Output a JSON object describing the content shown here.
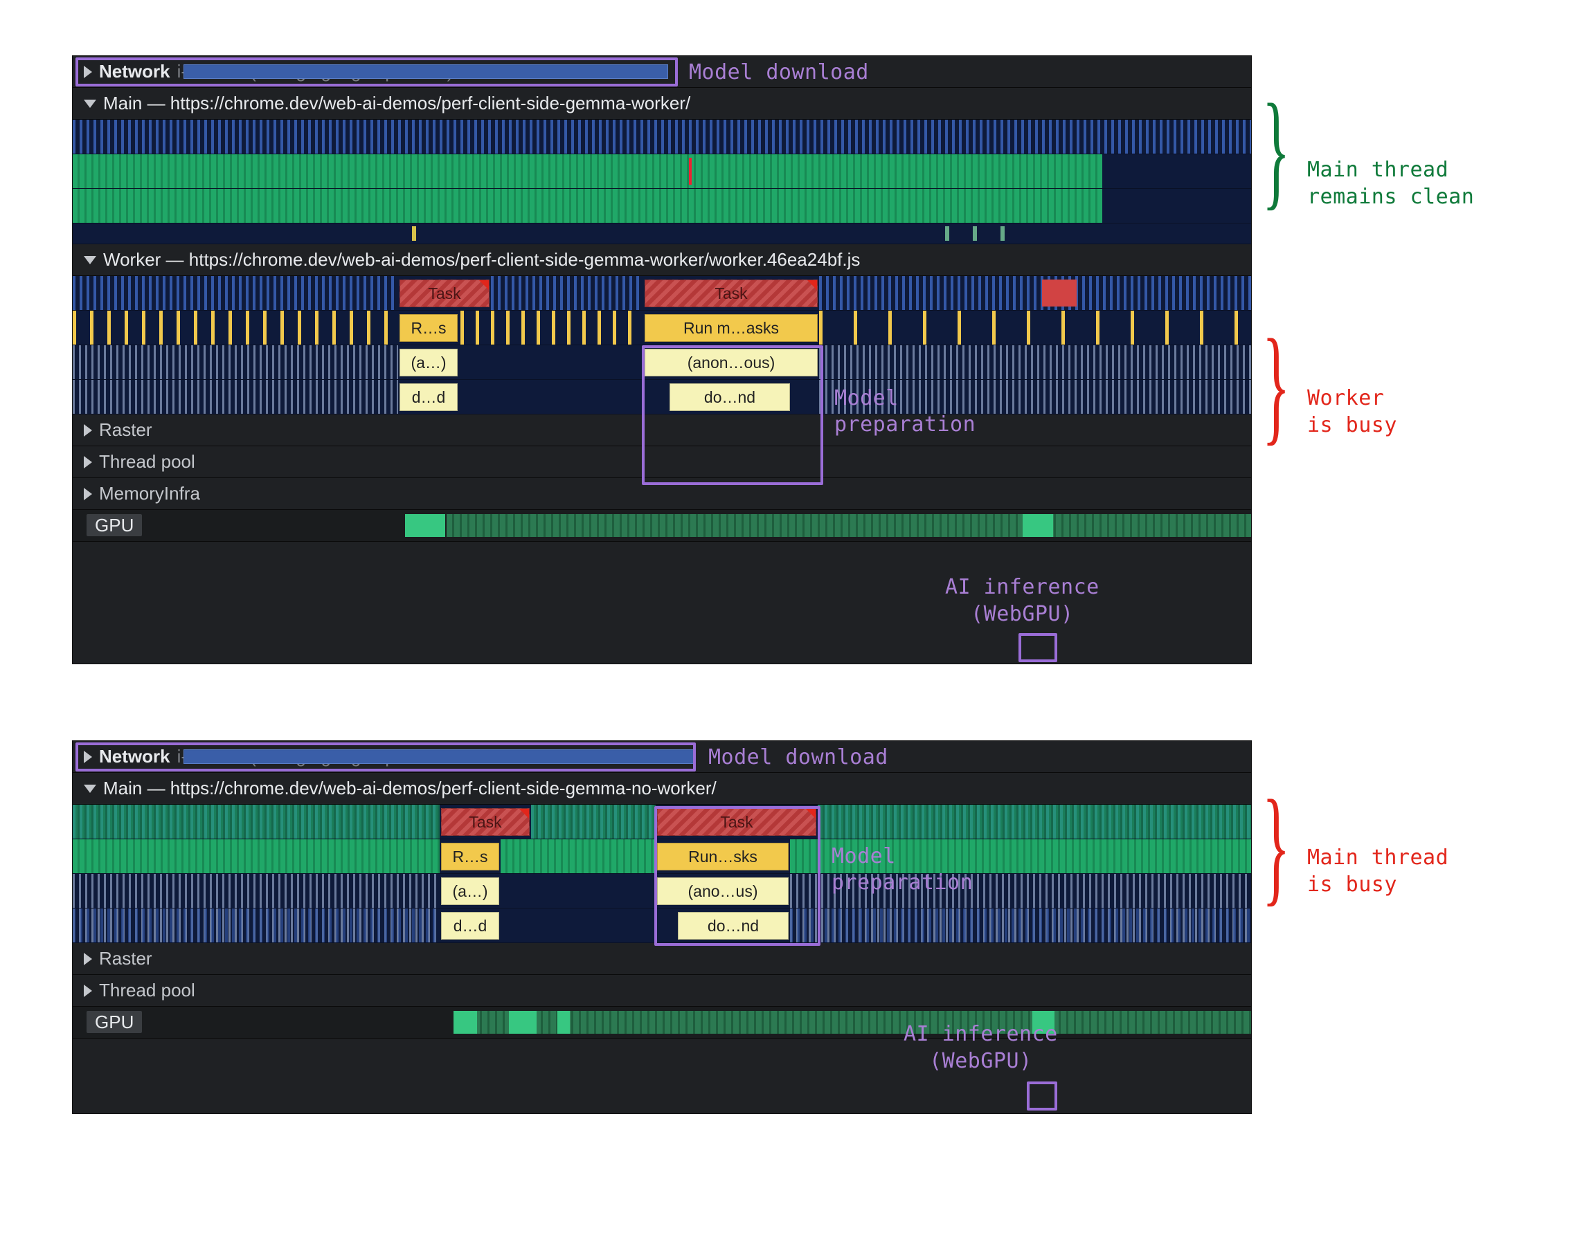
{
  "panel1": {
    "network_label": "Network",
    "network_detail": "i-int4.bin (storage.googleapis.com)",
    "main_label": "Main — https://chrome.dev/web-ai-demos/perf-client-side-gemma-worker/",
    "worker_label": "Worker — https://chrome.dev/web-ai-demos/perf-client-side-gemma-worker/worker.46ea24bf.js",
    "raster_label": "Raster",
    "threadpool_label": "Thread pool",
    "memoryinfra_label": "MemoryInfra",
    "gpu_label": "GPU",
    "worker_tasks": {
      "task_a": "Task",
      "task_b": "Task",
      "rs_a": "R…s",
      "rs_b": "Run m…asks",
      "anon_a": "(a…)",
      "anon_b": "(anon…ous)",
      "dd_a": "d…d",
      "dd_b": "do…nd"
    },
    "annotations": {
      "model_download": "Model download",
      "model_prep": "Model\npreparation",
      "ai_inference": "AI inference\n(WebGPU)",
      "main_clean": "Main thread\nremains clean",
      "worker_busy": "Worker\nis busy"
    }
  },
  "panel2": {
    "network_label": "Network",
    "network_detail": "i-int4.bin (storage.googleapis.co…",
    "main_label": "Main — https://chrome.dev/web-ai-demos/perf-client-side-gemma-no-worker/",
    "raster_label": "Raster",
    "threadpool_label": "Thread pool",
    "gpu_label": "GPU",
    "main_tasks": {
      "task_a": "Task",
      "task_b": "Task",
      "rs_a": "R…s",
      "rs_b": "Run…sks",
      "anon_a": "(a…)",
      "anon_b": "(ano…us)",
      "dd_a": "d…d",
      "dd_b": "do…nd"
    },
    "annotations": {
      "model_download": "Model download",
      "model_prep": "Model\npreparation",
      "ai_inference": "AI inference\n(WebGPU)",
      "main_busy": "Main thread\nis busy"
    }
  },
  "colors": {
    "purple": "#a97fd4",
    "green": "#0f7a3a",
    "red": "#e2261b"
  }
}
